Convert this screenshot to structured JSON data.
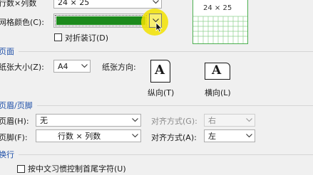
{
  "rows_cols": {
    "label": "行数×列数",
    "value": "24 × 25"
  },
  "grid_color": {
    "label": "网格颜色(C):",
    "swatch_color": "#1c8a1c"
  },
  "fold_binding": {
    "label": "对折装订(D)"
  },
  "preview": {
    "text": "24 × 25",
    "grid_color": "#4caf50"
  },
  "page_section": {
    "title": "页面",
    "paper_size_label": "纸张大小(Z):",
    "paper_size_value": "A4",
    "orientation_label": "纸张方向:",
    "portrait_label": "纵向(T)",
    "landscape_label": "横向(L)",
    "icon_letter": "A"
  },
  "header_footer_section": {
    "title": "页眉/页脚",
    "header_label": "页眉(H):",
    "header_value": "无",
    "header_align_label": "对齐方式(G):",
    "header_align_value": "右",
    "footer_label": "页脚(F):",
    "footer_value": "行数 × 列数",
    "footer_align_label": "对齐方式(A):",
    "footer_align_value": "左"
  },
  "line_break_section": {
    "title": "换行",
    "rule_label": "按中文习惯控制首尾字符(U)"
  },
  "cursor_highlight_color": "#f2e200"
}
